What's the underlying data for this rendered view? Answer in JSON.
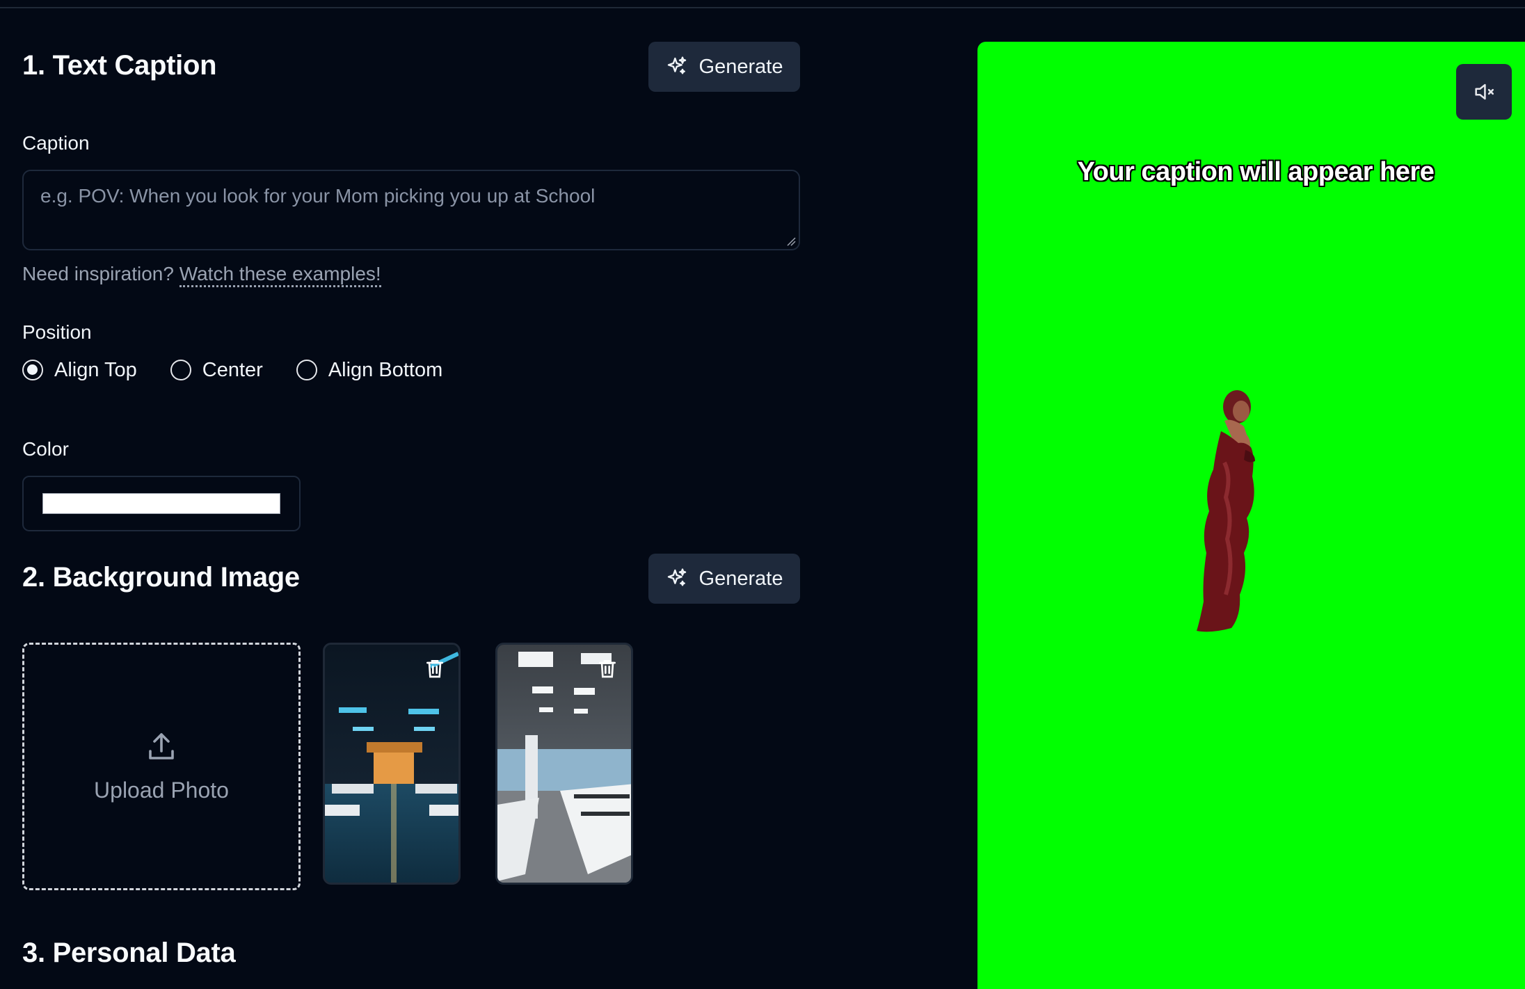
{
  "section1": {
    "title": "1. Text Caption",
    "generate_label": "Generate",
    "caption_label": "Caption",
    "caption_placeholder": "e.g. POV: When you look for your Mom picking you up at School",
    "caption_value": "",
    "inspiration_text": "Need inspiration?",
    "inspiration_link": "Watch these examples!",
    "position_label": "Position",
    "positions": [
      {
        "label": "Align Top",
        "checked": true
      },
      {
        "label": "Center",
        "checked": false
      },
      {
        "label": "Align Bottom",
        "checked": false
      }
    ],
    "color_label": "Color",
    "color_value": "#ffffff"
  },
  "section2": {
    "title": "2. Background Image",
    "generate_label": "Generate",
    "upload_label": "Upload Photo",
    "images": [
      "office-night-blue",
      "office-daylight-white"
    ]
  },
  "section3": {
    "title": "3. Personal Data"
  },
  "preview": {
    "caption": "Your caption will appear here",
    "background": "#01ff01",
    "mute_icon": "volume-muted-icon"
  }
}
